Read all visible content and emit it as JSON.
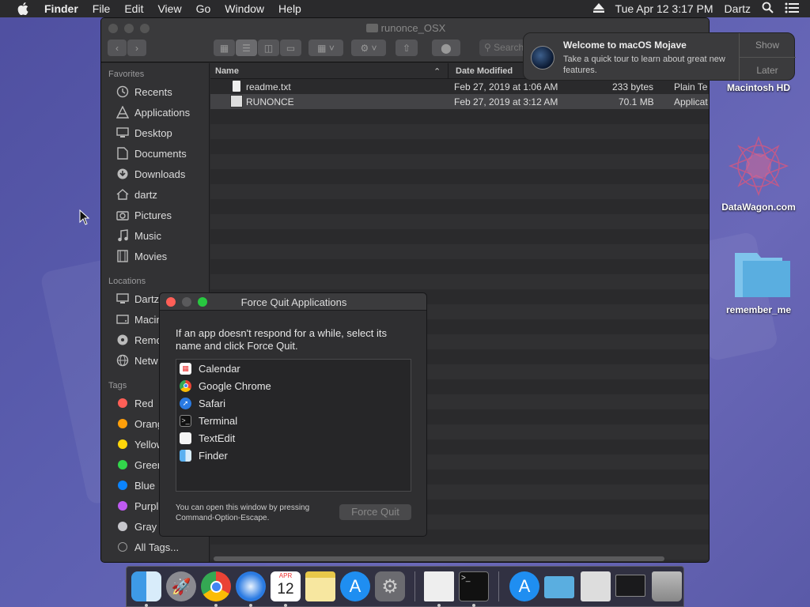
{
  "menubar": {
    "app_name": "Finder",
    "items": [
      "File",
      "Edit",
      "View",
      "Go",
      "Window",
      "Help"
    ],
    "clock": "Tue Apr 12  3:17 PM",
    "user": "Dartz"
  },
  "finder": {
    "title": "runonce_OSX",
    "search_placeholder": "Search",
    "sidebar": {
      "favorites_header": "Favorites",
      "favorites": [
        "Recents",
        "Applications",
        "Desktop",
        "Documents",
        "Downloads",
        "dartz",
        "Pictures",
        "Music",
        "Movies"
      ],
      "locations_header": "Locations",
      "locations": [
        "Dartz",
        "Macin",
        "Remo",
        "Netw"
      ],
      "tags_header": "Tags",
      "tags": [
        {
          "label": "Red",
          "color": "#ff5f57"
        },
        {
          "label": "Orang",
          "color": "#ff9f0a"
        },
        {
          "label": "Yellow",
          "color": "#ffd60a"
        },
        {
          "label": "Green",
          "color": "#32d74b"
        },
        {
          "label": "Blue",
          "color": "#0a84ff"
        },
        {
          "label": "Purple",
          "color": "#bf5af2"
        },
        {
          "label": "Gray",
          "color": "#c7c7cc"
        }
      ],
      "all_tags": "All Tags..."
    },
    "columns": {
      "name": "Name",
      "date_modified": "Date Modified"
    },
    "files": [
      {
        "name": "readme.txt",
        "date": "Feb 27, 2019 at 1:06 AM",
        "size": "233 bytes",
        "kind": "Plain Te"
      },
      {
        "name": "RUNONCE",
        "date": "Feb 27, 2019 at 3:12 AM",
        "size": "70.1 MB",
        "kind": "Applicat"
      }
    ]
  },
  "notification": {
    "title": "Welcome to macOS Mojave",
    "body": "Take a quick tour to learn about great new features.",
    "show_label": "Show",
    "later_label": "Later"
  },
  "desktop_icons": [
    {
      "label": "Macintosh HD"
    },
    {
      "label": "DataWagon.com"
    },
    {
      "label": "remember_me"
    }
  ],
  "force_quit": {
    "title": "Force Quit Applications",
    "instructions": "If an app doesn't respond for a while, select its name and click Force Quit.",
    "apps": [
      {
        "name": "Calendar",
        "icon": "calendar-icon"
      },
      {
        "name": "Google Chrome",
        "icon": "chrome-icon"
      },
      {
        "name": "Safari",
        "icon": "safari-icon"
      },
      {
        "name": "Terminal",
        "icon": "terminal-icon"
      },
      {
        "name": "TextEdit",
        "icon": "textedit-icon"
      },
      {
        "name": "Finder",
        "icon": "finder-icon"
      }
    ],
    "hint": "You can open this window by pressing Command-Option-Escape.",
    "button": "Force Quit"
  },
  "dock": {
    "calendar_day": "12",
    "calendar_month": "APR"
  },
  "colors": {
    "close": "#ff5f57",
    "minimize": "#febc2e",
    "zoom": "#28c840",
    "desktop": "#5c5fb0"
  }
}
